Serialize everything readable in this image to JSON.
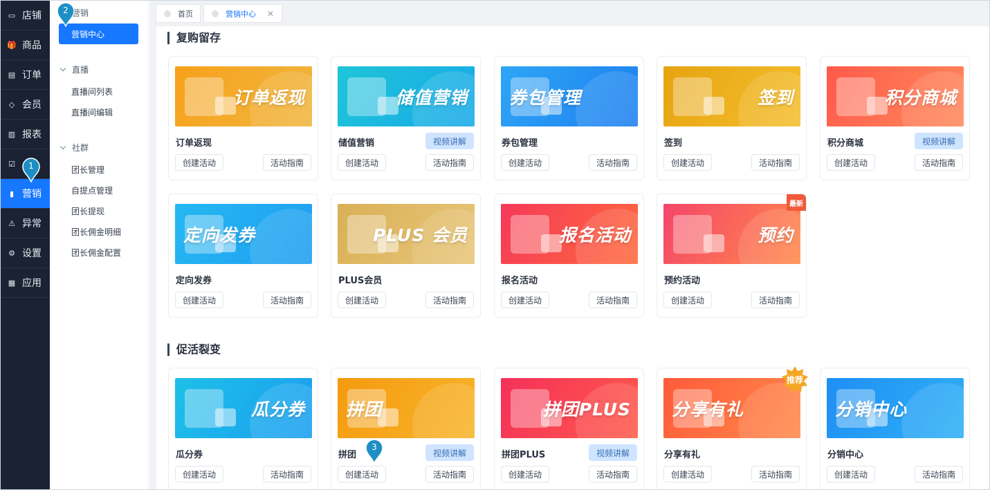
{
  "left_nav": {
    "items": [
      {
        "label": "店铺",
        "icon": "store-icon"
      },
      {
        "label": "商品",
        "icon": "gift-icon"
      },
      {
        "label": "订单",
        "icon": "order-icon"
      },
      {
        "label": "会员",
        "icon": "diamond-icon"
      },
      {
        "label": "报表",
        "icon": "chart-icon"
      },
      {
        "label": "",
        "icon": "data-icon"
      },
      {
        "label": "营销",
        "icon": "marketing-icon",
        "active": true
      },
      {
        "label": "异常",
        "icon": "warning-icon"
      },
      {
        "label": "设置",
        "icon": "gear-icon"
      },
      {
        "label": "应用",
        "icon": "apps-icon"
      }
    ]
  },
  "sub_nav": {
    "title": "营销",
    "active_item": "营销中心",
    "groups": [
      {
        "label": "直播",
        "items": [
          "直播间列表",
          "直播间编辑"
        ]
      },
      {
        "label": "社群",
        "items": [
          "团长管理",
          "自提点管理",
          "团长提现",
          "团长佣金明细",
          "团长佣金配置"
        ]
      }
    ]
  },
  "tabs": [
    {
      "label": "首页",
      "active": false
    },
    {
      "label": "营销中心",
      "active": true,
      "closable": true
    }
  ],
  "sections": [
    {
      "title": "复购留存",
      "cards": [
        {
          "name": "订单返现",
          "banner_text": "订单返现",
          "video": "",
          "create": "创建活动",
          "guide": "活动指南",
          "color1": "#f7a11a",
          "color2": "#f0b640"
        },
        {
          "name": "储值营销",
          "banner_text": "储值营销",
          "video": "视频讲解",
          "create": "创建活动",
          "guide": "活动指南",
          "color1": "#1ec5d8",
          "color2": "#19a9e8"
        },
        {
          "name": "券包管理",
          "banner_text": "券包管理",
          "video": "",
          "create": "创建活动",
          "guide": "活动指南",
          "color1": "#2ea6f5",
          "color2": "#1e7ff0"
        },
        {
          "name": "签到",
          "banner_text": "签到",
          "video": "",
          "create": "创建活动",
          "guide": "活动指南",
          "color1": "#e6a310",
          "color2": "#f5bf2e"
        },
        {
          "name": "积分商城",
          "banner_text": "积分商城",
          "video": "视频讲解",
          "create": "创建活动",
          "guide": "活动指南",
          "color1": "#ff5a4a",
          "color2": "#ff8a5c"
        },
        {
          "name": "定向发券",
          "banner_text": "定向发券",
          "video": "",
          "create": "创建活动",
          "guide": "活动指南",
          "color1": "#26b8f2",
          "color2": "#1e9ef0"
        },
        {
          "name": "PLUS会员",
          "banner_text": "PLUS 会员",
          "video": "",
          "create": "创建活动",
          "guide": "活动指南",
          "color1": "#d9b056",
          "color2": "#e8c67a"
        },
        {
          "name": "报名活动",
          "banner_text": "报名活动",
          "video": "",
          "create": "创建活动",
          "guide": "活动指南",
          "color1": "#f5395a",
          "color2": "#ff6a3c"
        },
        {
          "name": "预约活动",
          "banner_text": "预约",
          "video": "",
          "create": "创建活动",
          "guide": "活动指南",
          "color1": "#f5456a",
          "color2": "#ff8a4a",
          "corner": "最新"
        }
      ]
    },
    {
      "title": "促活裂变",
      "cards": [
        {
          "name": "瓜分券",
          "banner_text": "瓜分券",
          "video": "",
          "create": "创建活动",
          "guide": "活动指南",
          "color1": "#1ec0e8",
          "color2": "#1a9ef0"
        },
        {
          "name": "拼团",
          "banner_text": "拼团",
          "video": "视频讲解",
          "create": "创建活动",
          "guide": "活动指南",
          "color1": "#f59a10",
          "color2": "#f7b52a"
        },
        {
          "name": "拼团PLUS",
          "banner_text": "拼团PLUS",
          "video": "视频讲解",
          "create": "创建活动",
          "guide": "活动指南",
          "color1": "#f5305a",
          "color2": "#ff5a4a"
        },
        {
          "name": "分享有礼",
          "banner_text": "分享有礼",
          "video": "",
          "create": "创建活动",
          "guide": "活动指南",
          "color1": "#ff5a3a",
          "color2": "#ff8a4a",
          "badge": "推荐"
        },
        {
          "name": "分销中心",
          "banner_text": "分销中心",
          "video": "",
          "create": "创建活动",
          "guide": "活动指南",
          "color1": "#1e8ff5",
          "color2": "#2fb0f5"
        }
      ]
    }
  ],
  "markers": [
    "1",
    "2",
    "3"
  ],
  "colors": {
    "accent": "#1677ff",
    "nav_bg": "#1a2233",
    "marker": "#1d8fc4"
  }
}
